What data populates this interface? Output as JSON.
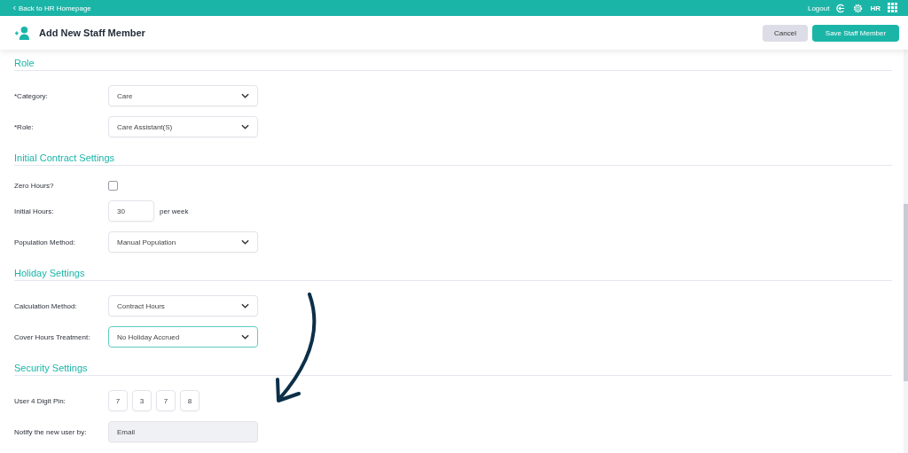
{
  "top_bar": {
    "back_link": "Back to HR Homepage",
    "logout": "Logout",
    "user_initials": "HR"
  },
  "header": {
    "title": "Add New Staff Member",
    "buttons": [
      {
        "label": "Cancel",
        "kind": "secondary"
      },
      {
        "label": "Save Staff Member",
        "kind": "primary"
      }
    ]
  },
  "sections": [
    {
      "title": "Role",
      "rows": [
        {
          "label": "*Category:",
          "kind": "select",
          "value": "Care",
          "focused": false
        },
        {
          "label": "*Role:",
          "kind": "select",
          "value": "Care Assistant(S)",
          "focused": false
        }
      ]
    },
    {
      "title": "Initial Contract Settings",
      "rows": [
        {
          "label": "Zero Hours?",
          "kind": "checkbox",
          "checked": false
        },
        {
          "label": "Initial Hours:",
          "kind": "number",
          "value": "30",
          "suffix": "per week"
        },
        {
          "label": "Population Method:",
          "kind": "select",
          "value": "Manual Population",
          "focused": false
        }
      ]
    },
    {
      "title": "Holiday Settings",
      "rows": [
        {
          "label": "Calculation Method:",
          "kind": "select",
          "value": "Contract Hours",
          "focused": false
        },
        {
          "label": "Cover Hours Treatment:",
          "kind": "select",
          "value": "No Holiday Accrued",
          "focused": true
        }
      ]
    },
    {
      "title": "Security Settings",
      "rows": [
        {
          "label": "User 4 Digit Pin:",
          "kind": "pin",
          "digits": [
            "7",
            "3",
            "7",
            "8"
          ]
        },
        {
          "label": "Notify the new user by:",
          "kind": "readonly",
          "value": "Email"
        }
      ]
    }
  ]
}
